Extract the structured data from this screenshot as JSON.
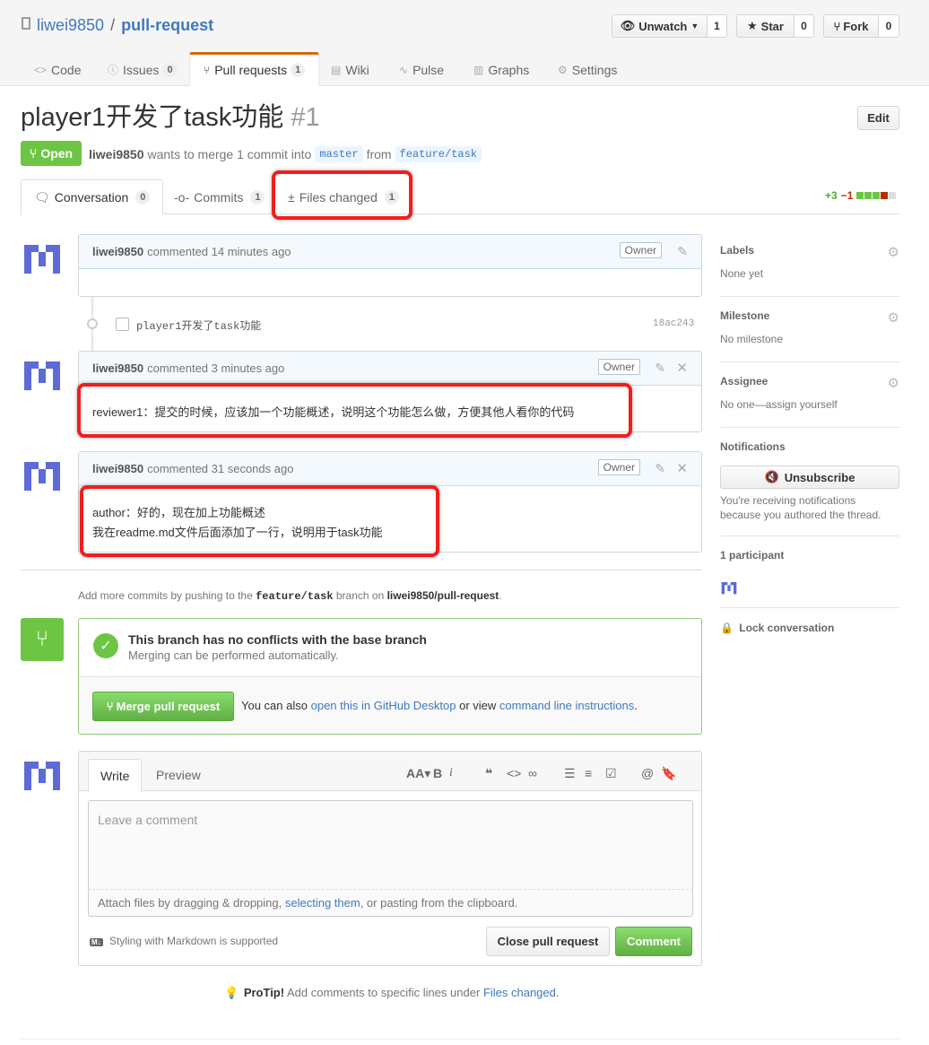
{
  "repo": {
    "owner": "liwei9850",
    "separator": "/",
    "name": "pull-request"
  },
  "actions": {
    "watch_label": "Unwatch",
    "watch_count": "1",
    "star_label": "Star",
    "star_count": "0",
    "fork_label": "Fork",
    "fork_count": "0"
  },
  "reponav": {
    "code": "Code",
    "issues": "Issues",
    "issues_count": "0",
    "pulls": "Pull requests",
    "pulls_count": "1",
    "wiki": "Wiki",
    "pulse": "Pulse",
    "graphs": "Graphs",
    "settings": "Settings"
  },
  "pr": {
    "title": "player1开发了task功能",
    "number": "#1",
    "edit_label": "Edit",
    "state": "Open",
    "author": "liwei9850",
    "merge_text": "wants to merge 1 commit into",
    "base": "master",
    "from_text": "from",
    "head": "feature/task"
  },
  "tabs": {
    "conversation": "Conversation",
    "conversation_count": "0",
    "commits": "Commits",
    "commits_count": "1",
    "files": "Files changed",
    "files_count": "1",
    "additions": "+3",
    "deletions": "−1"
  },
  "comments": [
    {
      "author": "liwei9850",
      "meta": "commented 14 minutes ago",
      "badge": "Owner",
      "body": []
    },
    {
      "author": "liwei9850",
      "meta": "commented 3 minutes ago",
      "badge": "Owner",
      "body": [
        "reviewer1：提交的时候，应该加一个功能概述，说明这个功能怎么做，方便其他人看你的代码"
      ]
    },
    {
      "author": "liwei9850",
      "meta": "commented 31 seconds ago",
      "badge": "Owner",
      "body": [
        "author：好的，现在加上功能概述",
        "我在readme.md文件后面添加了一行，说明用于task功能"
      ]
    }
  ],
  "commit": {
    "message": "player1开发了task功能",
    "sha": "18ac243"
  },
  "push_hint": {
    "prefix": "Add more commits by pushing to the",
    "branch": "feature/task",
    "mid": "branch on",
    "repo": "liwei9850/pull-request",
    "suffix": "."
  },
  "merge": {
    "title": "This branch has no conflicts with the base branch",
    "subtitle": "Merging can be performed automatically.",
    "button": "Merge pull request",
    "also": "You can also",
    "desktop_link": "open this in GitHub Desktop",
    "or_view": "or view",
    "cli_link": "command line instructions",
    "end": "."
  },
  "composer": {
    "write_tab": "Write",
    "preview_tab": "Preview",
    "placeholder": "Leave a comment",
    "attach_prefix": "Attach files by dragging & dropping,",
    "attach_link": "selecting them",
    "attach_suffix": ", or pasting from the clipboard.",
    "markdown_note": "Styling with Markdown is supported",
    "close_button": "Close pull request",
    "comment_button": "Comment"
  },
  "protip": {
    "label": "ProTip!",
    "text": "Add comments to specific lines under",
    "link": "Files changed",
    "end": "."
  },
  "sidebar": {
    "labels_title": "Labels",
    "labels_value": "None yet",
    "milestone_title": "Milestone",
    "milestone_value": "No milestone",
    "assignee_title": "Assignee",
    "assignee_value": "No one—assign yourself",
    "notifications_title": "Notifications",
    "unsubscribe": "Unsubscribe",
    "notif_line1": "You're receiving notifications",
    "notif_line2": "because you authored the thread.",
    "participants": "1 participant",
    "lock": "Lock conversation"
  },
  "colors": {
    "link": "#4078c0",
    "open_green": "#6cc644",
    "accent_orange": "#d26911",
    "annotation_red": "#f31d1d"
  }
}
